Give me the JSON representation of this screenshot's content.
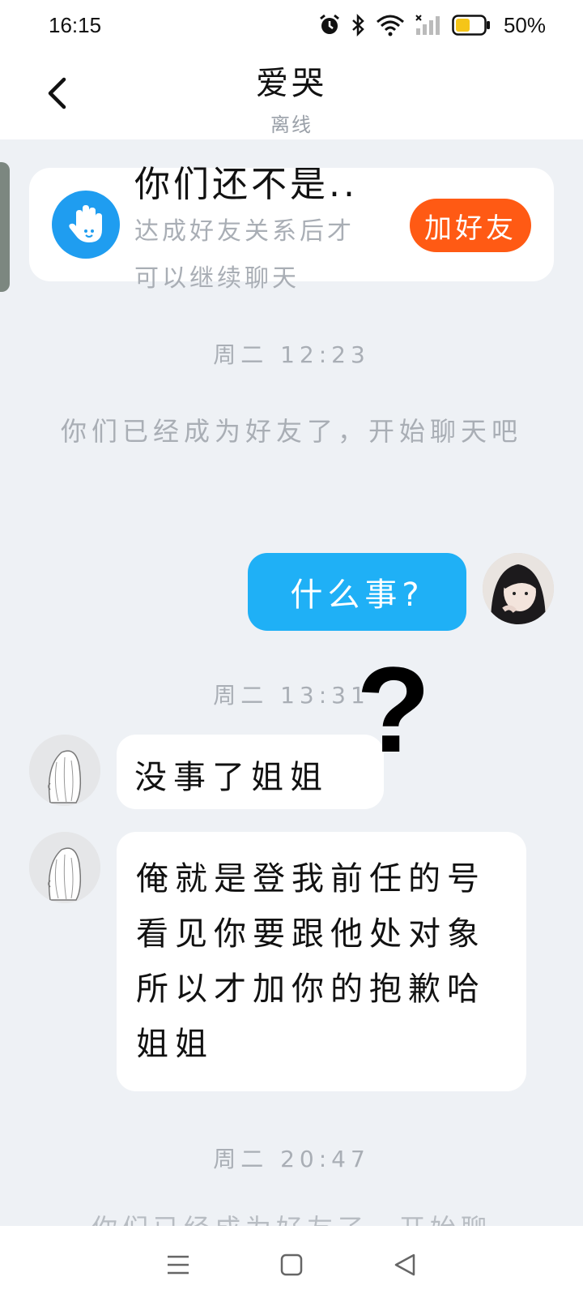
{
  "status_bar": {
    "time": "16:15",
    "battery": "50%",
    "icons": [
      "alarm-icon",
      "bluetooth-icon",
      "wifi-icon",
      "signal-icon",
      "battery-icon"
    ],
    "battery_level": 0.5,
    "battery_color": "#f5c518"
  },
  "header": {
    "title": "爱哭",
    "subtitle": "离线",
    "back_icon": "chevron-left-icon"
  },
  "banner": {
    "title": "你们还不是..",
    "description": "达成好友关系后才可以继续聊天",
    "button_label": "加好友",
    "icon": "hand-wave-icon",
    "accent": "#ff5a14"
  },
  "messages": {
    "ts1": "周二 12:23",
    "system1": "你们已经成为好友了，开始聊天吧",
    "out1": "什么事?",
    "ts2": "周二 13:31",
    "overlay_mark": "?",
    "in1": "没事了姐姐",
    "in2": "俺就是登我前任的号看见你要跟他处对象所以才加你的抱歉哈姐姐",
    "ts3": "周二 20:47",
    "system2_partial": "你们已经成为好友了，开始聊"
  },
  "nav": {
    "items": [
      "menu-icon",
      "home-icon",
      "back-triangle-icon"
    ]
  },
  "colors": {
    "bubble_out": "#1fb0f6",
    "background": "#eef1f5"
  }
}
